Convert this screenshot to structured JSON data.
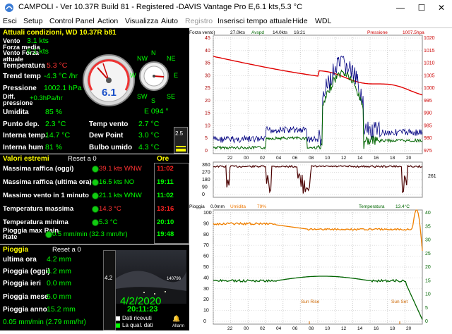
{
  "window": {
    "title": "CAMPOLI - Ver 10.37R Build 81 - Registered  -DAVIS Vantage Pro   E,6.1 kts,5.3 °C",
    "minimize": "—",
    "maximize": "☐",
    "close": "✕"
  },
  "menu": [
    "Esci",
    "Setup",
    "Control Panel",
    "Action",
    "Visualizza",
    "Aiuto",
    "Registro",
    "Inserisci tempo attuale",
    "Hide",
    "WDL"
  ],
  "current": {
    "header": "Attuali condizioni, WD 10.37R b81",
    "rows": [
      {
        "label": "Vento",
        "value": "3.1 kts"
      },
      {
        "label": "Forza media",
        "value": ""
      },
      {
        "label": "Vento Forza attuale",
        "value": "6.1 kts"
      },
      {
        "label": "Temperatura",
        "value": "5.3 °C"
      },
      {
        "label": "Trend temp",
        "value": "-4.3 °C /hr"
      },
      {
        "label": "Pressione",
        "value": "1002.1 hPa"
      },
      {
        "label": "Diff. pressione",
        "value": "+0.3hPa/hr"
      },
      {
        "label": "Umidita",
        "value": "85 %"
      },
      {
        "label": "Punto dep.",
        "value": "2.3 °C"
      },
      {
        "label": "Interna temp.",
        "value": "14.7 °C"
      },
      {
        "label": "Interna hum",
        "value": "81 %"
      }
    ],
    "right_rows": [
      {
        "label": "Temp vento",
        "value": "2.7 °C"
      },
      {
        "label": "Dew Point",
        "value": "3.0 °C"
      },
      {
        "label": "Bulbo umido",
        "value": "4.3 °C"
      }
    ],
    "gauge_value": "6.1",
    "compass": {
      "n": "N",
      "e": "E",
      "s": "S",
      "w": "W",
      "nw": "NW",
      "ne": "NE",
      "sw": "SW",
      "se": "SE"
    },
    "direction": "E  094 °",
    "bar_value": "2.5"
  },
  "extremes": {
    "header": "Valori estremi",
    "reset": "Reset a 0",
    "ore_header": "Ore",
    "rows": [
      {
        "label": "Massima raffica (oggi)",
        "value": "39.1 kts WNW",
        "time": "11:02",
        "red": true
      },
      {
        "label": "Massima raffica (ultima ora)",
        "value": "16.5 kts  NO",
        "time": "19:11",
        "red": false
      },
      {
        "label": "Massimo vento in 1 minuto",
        "value": "21.1 kts WNW",
        "time": "11:02",
        "red": false
      },
      {
        "label": "Temperatura massima",
        "value": "14.3 °C",
        "time": "13:16",
        "red": true
      },
      {
        "label": "Temperatura minima",
        "value": "5.3 °C",
        "time": "20:10",
        "red": false
      },
      {
        "label": "Pioggia max Rain Rate",
        "value": "0.5 mm/min (32.3 mm/hr)",
        "time": "19:48",
        "red": false
      }
    ]
  },
  "rain": {
    "header": "Pioggia",
    "reset": "Reset a 0",
    "rows": [
      {
        "label": "ultima ora",
        "value": "4.2 mm"
      },
      {
        "label": "Pioggia (oggi)",
        "value": "4.2 mm"
      },
      {
        "label": "Pioggia ieri",
        "value": "0.0 mm"
      },
      {
        "label": "Pioggia mese",
        "value": "5.0 mm"
      },
      {
        "label": "Pioggia anno",
        "value": "15.2 mm"
      }
    ],
    "rate": "0.05 mm/min (2.79 mm/hr)",
    "bar_label": "4.2",
    "cam_counter": "140796",
    "date": "4/2/2020",
    "time": "20:11:23",
    "legend": [
      "Dati ricevuti",
      "La qual. dati"
    ],
    "allarm": "Allarm"
  },
  "graphs": {
    "wind_pressure": {
      "label_left": "Forza vento)",
      "label_avg": "27.0kts",
      "label_avgname": "Avspd",
      "label_cur": "14.0kts",
      "label_time": "16:21",
      "label_pressure": "Pressione",
      "label_pval": "1007.5hpa",
      "left_ticks": [
        "45",
        "40",
        "35",
        "30",
        "25",
        "20",
        "15",
        "10",
        "5",
        "0"
      ],
      "right_ticks": [
        "1020",
        "1015",
        "1010",
        "1005",
        "1000",
        "995",
        "990",
        "985",
        "980",
        "975"
      ],
      "x_ticks": [
        "22",
        "00",
        "02",
        "04",
        "06",
        "08",
        "10",
        "12",
        "14",
        "16",
        "18",
        "20"
      ]
    },
    "direction": {
      "ticks": [
        "360",
        "270",
        "180",
        "90",
        "0"
      ],
      "right_label": "261"
    },
    "humidity_temp": {
      "label_rain": "Pioggia",
      "label_rainval": "0.0mm",
      "label_hum": "Umidita",
      "label_humval": "79%",
      "label_temp": "Temperatura",
      "label_tempval": "13.4°C",
      "left_ticks": [
        "100",
        "90",
        "80",
        "70",
        "60",
        "50",
        "40",
        "30",
        "20",
        "10",
        "0"
      ],
      "right_ticks": [
        "40",
        "35",
        "30",
        "25",
        "20",
        "15",
        "10",
        "5",
        "0"
      ],
      "sunrise": "Sun Rise",
      "sunset": "Sun Set",
      "x_ticks": [
        "22",
        "00",
        "02",
        "04",
        "06",
        "08",
        "10",
        "12",
        "14",
        "16",
        "18",
        "20"
      ]
    }
  },
  "colors": {
    "panel_bg": "#000000",
    "header_yellow": "#ffff00",
    "value_green": "#00ff00",
    "alert_red": "#ff3333",
    "pressure_line": "#e00000",
    "wind_line": "#000080",
    "avg_wind_line": "#006400",
    "direction_line": "#4a0000",
    "humidity_line": "#f08000",
    "temp_line": "#006400"
  }
}
